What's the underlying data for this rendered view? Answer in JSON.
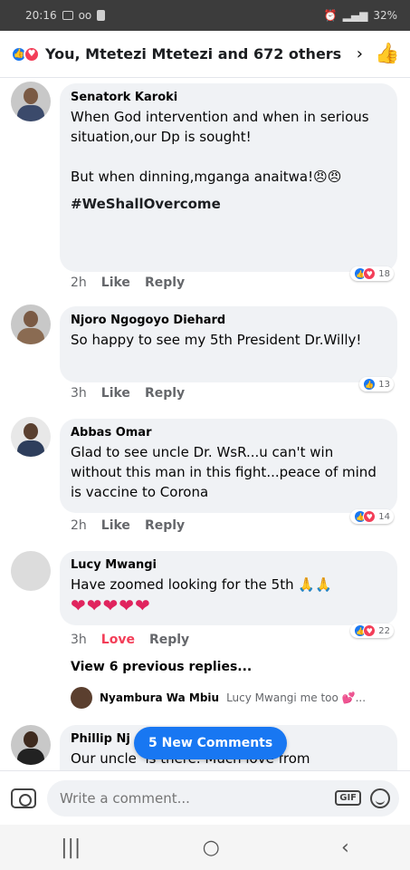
{
  "status_bar": {
    "time": "20:16",
    "battery": "32%"
  },
  "header": {
    "text": "You, Mtetezi Mtetezi and 672 others",
    "chevron": "›"
  },
  "comments": [
    {
      "name": "Senatork Karoki",
      "text": "When God intervention and when in serious situation,our Dp is sought!\n\nBut when dinning,mganga anaitwa!😠😠",
      "tag": "#WeShallOvercome",
      "time": "2h",
      "action": "Like",
      "reply": "Reply",
      "reactions": "18"
    },
    {
      "name": "Njoro Ngogoyo Diehard",
      "text": "So happy to see my 5th President Dr.Willy!",
      "time": "3h",
      "action": "Like",
      "reply": "Reply",
      "reactions": "13"
    },
    {
      "name": "Abbas Omar",
      "text": "Glad to see uncle Dr. WsR...u can't win without this man in this fight...peace of mind is vaccine to Corona",
      "time": "2h",
      "action": "Like",
      "reply": "Reply",
      "reactions": "14"
    },
    {
      "name": "Lucy Mwangi",
      "text": "Have zoomed looking for the 5th 🙏🙏",
      "hearts": "❤❤❤❤❤",
      "time": "3h",
      "action": "Love",
      "reply": "Reply",
      "reactions": "22"
    },
    {
      "name": "Phillip Nj",
      "text": "Our uncle  is there. Much love from"
    }
  ],
  "view_previous": "View 6 previous replies...",
  "reply_preview": {
    "name": "Nyambura Wa Mbiu",
    "text": "Lucy Mwangi me too 💕..."
  },
  "new_comments_label": "5 New Comments",
  "composer": {
    "placeholder": "Write a comment...",
    "gif": "GIF"
  },
  "nav": {
    "recent": "|||",
    "home": "○",
    "back": "‹"
  }
}
